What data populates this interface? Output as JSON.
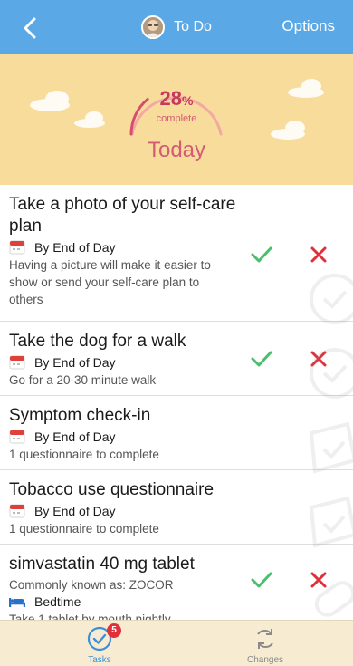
{
  "nav": {
    "title": "To Do",
    "options_label": "Options"
  },
  "progress": {
    "percent_value": 28,
    "percent_number": "28",
    "percent_symbol": "%",
    "complete_label": "complete",
    "day_label": "Today"
  },
  "tasks": [
    {
      "name": "Take a photo of your self-care plan",
      "due_icon": "calendar-icon",
      "due": "By End of Day",
      "description": "Having a picture will make it easier to show or send your self-care plan to others",
      "actions": true
    },
    {
      "name": "Take the dog for a walk",
      "due_icon": "calendar-icon",
      "due": "By End of Day",
      "description": "Go for a 20-30 minute walk",
      "actions": true
    },
    {
      "name": "Symptom check-in",
      "due_icon": "calendar-icon",
      "due": "By End of Day",
      "description": "1 questionnaire to complete",
      "actions": false
    },
    {
      "name": "Tobacco use questionnaire",
      "due_icon": "calendar-icon",
      "due": "By End of Day",
      "description": "1 questionnaire to complete",
      "actions": false
    },
    {
      "name": "simvastatin 40 mg tablet",
      "subtitle": "Commonly known as: ZOCOR",
      "due_icon": "bed-icon",
      "due": "Bedtime",
      "description": "Take 1 tablet by mouth nightly.",
      "actions": true
    }
  ],
  "tabbar": {
    "tasks_label": "Tasks",
    "tasks_badge": "5",
    "changes_label": "Changes"
  },
  "colors": {
    "nav": "#5aa9e6",
    "hero": "#f7dc9b",
    "accent": "#d45a76",
    "check": "#4cbf6d",
    "reject": "#e0303a",
    "tabbar": "#f7ecd1"
  }
}
